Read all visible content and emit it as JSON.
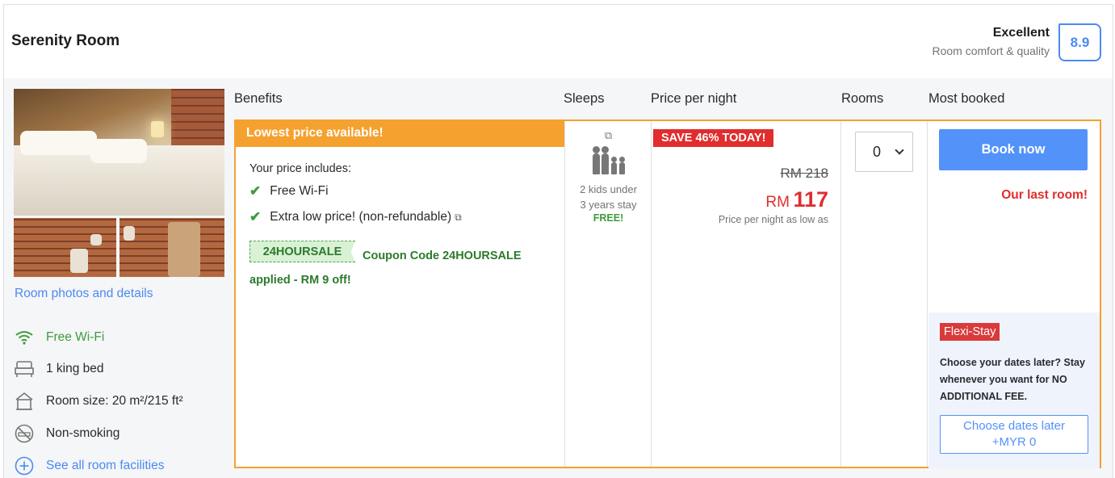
{
  "room": {
    "name": "Serenity Room",
    "review_label": "Excellent",
    "review_sub": "Room comfort & quality",
    "score": "8.9"
  },
  "photos_link": "Room photos and details",
  "facilities": [
    {
      "icon": "wifi-icon",
      "label": "Free Wi-Fi"
    },
    {
      "icon": "bed-icon",
      "label": "1 king bed"
    },
    {
      "icon": "room-size-icon",
      "label": "Room size: 20 m²/215 ft²"
    },
    {
      "icon": "no-smoking-icon",
      "label": "Non-smoking"
    },
    {
      "icon": "plus-circle-icon",
      "label": "See all room facilities"
    }
  ],
  "columns": {
    "benefits": "Benefits",
    "sleeps": "Sleeps",
    "price": "Price per night",
    "rooms": "Rooms",
    "most_booked": "Most booked"
  },
  "offer": {
    "banner": "Lowest price available!",
    "includes_title": "Your price includes:",
    "benefits": [
      "Free Wi-Fi",
      "Extra low price! (non-refundable)"
    ],
    "coupon_code": "24HOURSALE",
    "coupon_text": "Coupon Code 24HOURSALE applied - RM 9 off!",
    "sleeps_text_1": "2 kids under",
    "sleeps_text_2": "3 years stay",
    "sleeps_free": "FREE!",
    "save_badge": "SAVE 46% TODAY!",
    "old_price": "RM 218",
    "currency": "RM",
    "price": "117",
    "price_note": "Price per night as low as",
    "rooms_selected": "0",
    "book_label": "Book now",
    "last_room": "Our last room!"
  },
  "flexi": {
    "badge": "Flexi-Stay",
    "text_1": "Choose your dates later? Stay whenever you want for NO ADDITIONAL FEE.",
    "button_line1": "Choose dates later",
    "button_line2": "+MYR 0"
  },
  "colors": {
    "accent_orange": "#f5a12f",
    "primary_blue": "#5392f9",
    "sale_red": "#e12d2d",
    "success_green": "#3f9b3f"
  }
}
